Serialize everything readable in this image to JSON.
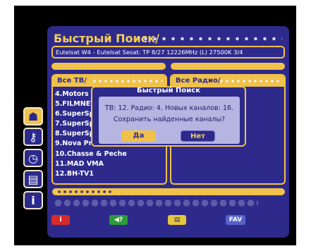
{
  "header": {
    "title": "Быстрый Поиск/"
  },
  "satellite_info": "Eutelsat W4 - Eutelsat Sesat: TP 8/27 12226MHz (L) 27500K 3/4",
  "tv_list": {
    "header": "Все ТВ/",
    "channels": [
      "4.Motors T",
      "5.FILMNET",
      "6.SuperSp",
      "7.SuperSp",
      "8.SuperSp",
      "9.Nova Pro",
      "10.Chasse & Peche",
      "11.MAD VMA",
      "12.BH-TV1"
    ]
  },
  "radio_list": {
    "header": "Все Радио/"
  },
  "dialog": {
    "title": "Быстрый Поиск",
    "message_line1": "ТВ: 12. Радио: 4. Новых каналов: 16.",
    "message_line2": "Сохранить найденные каналы?",
    "yes_label": "Да",
    "no_label": "Нет"
  },
  "sidebar_icons": [
    {
      "icon": "satellite-dish-icon",
      "glyph": "☗",
      "active": true
    },
    {
      "icon": "key-icon",
      "glyph": "⚷",
      "active": false
    },
    {
      "icon": "clock-icon",
      "glyph": "◷",
      "active": false
    },
    {
      "icon": "list-icon",
      "glyph": "▤",
      "active": false
    },
    {
      "icon": "info-icon",
      "glyph": "i",
      "active": false
    }
  ],
  "bottom_buttons": [
    {
      "icon": "info-icon",
      "glyph": "i",
      "color": "#d62b2b"
    },
    {
      "icon": "volume-question-icon",
      "glyph": "◀?",
      "color": "#2f9a3a"
    },
    {
      "icon": "page-icon",
      "glyph": "▤",
      "color": "#e6c63a"
    },
    {
      "label": "FAV",
      "color": "#5561c9"
    }
  ],
  "colors": {
    "panel": "#2d2a8c",
    "accent": "#f0c24b",
    "title_text": "#f6cf53",
    "dialog_body": "#b6b4e1"
  }
}
